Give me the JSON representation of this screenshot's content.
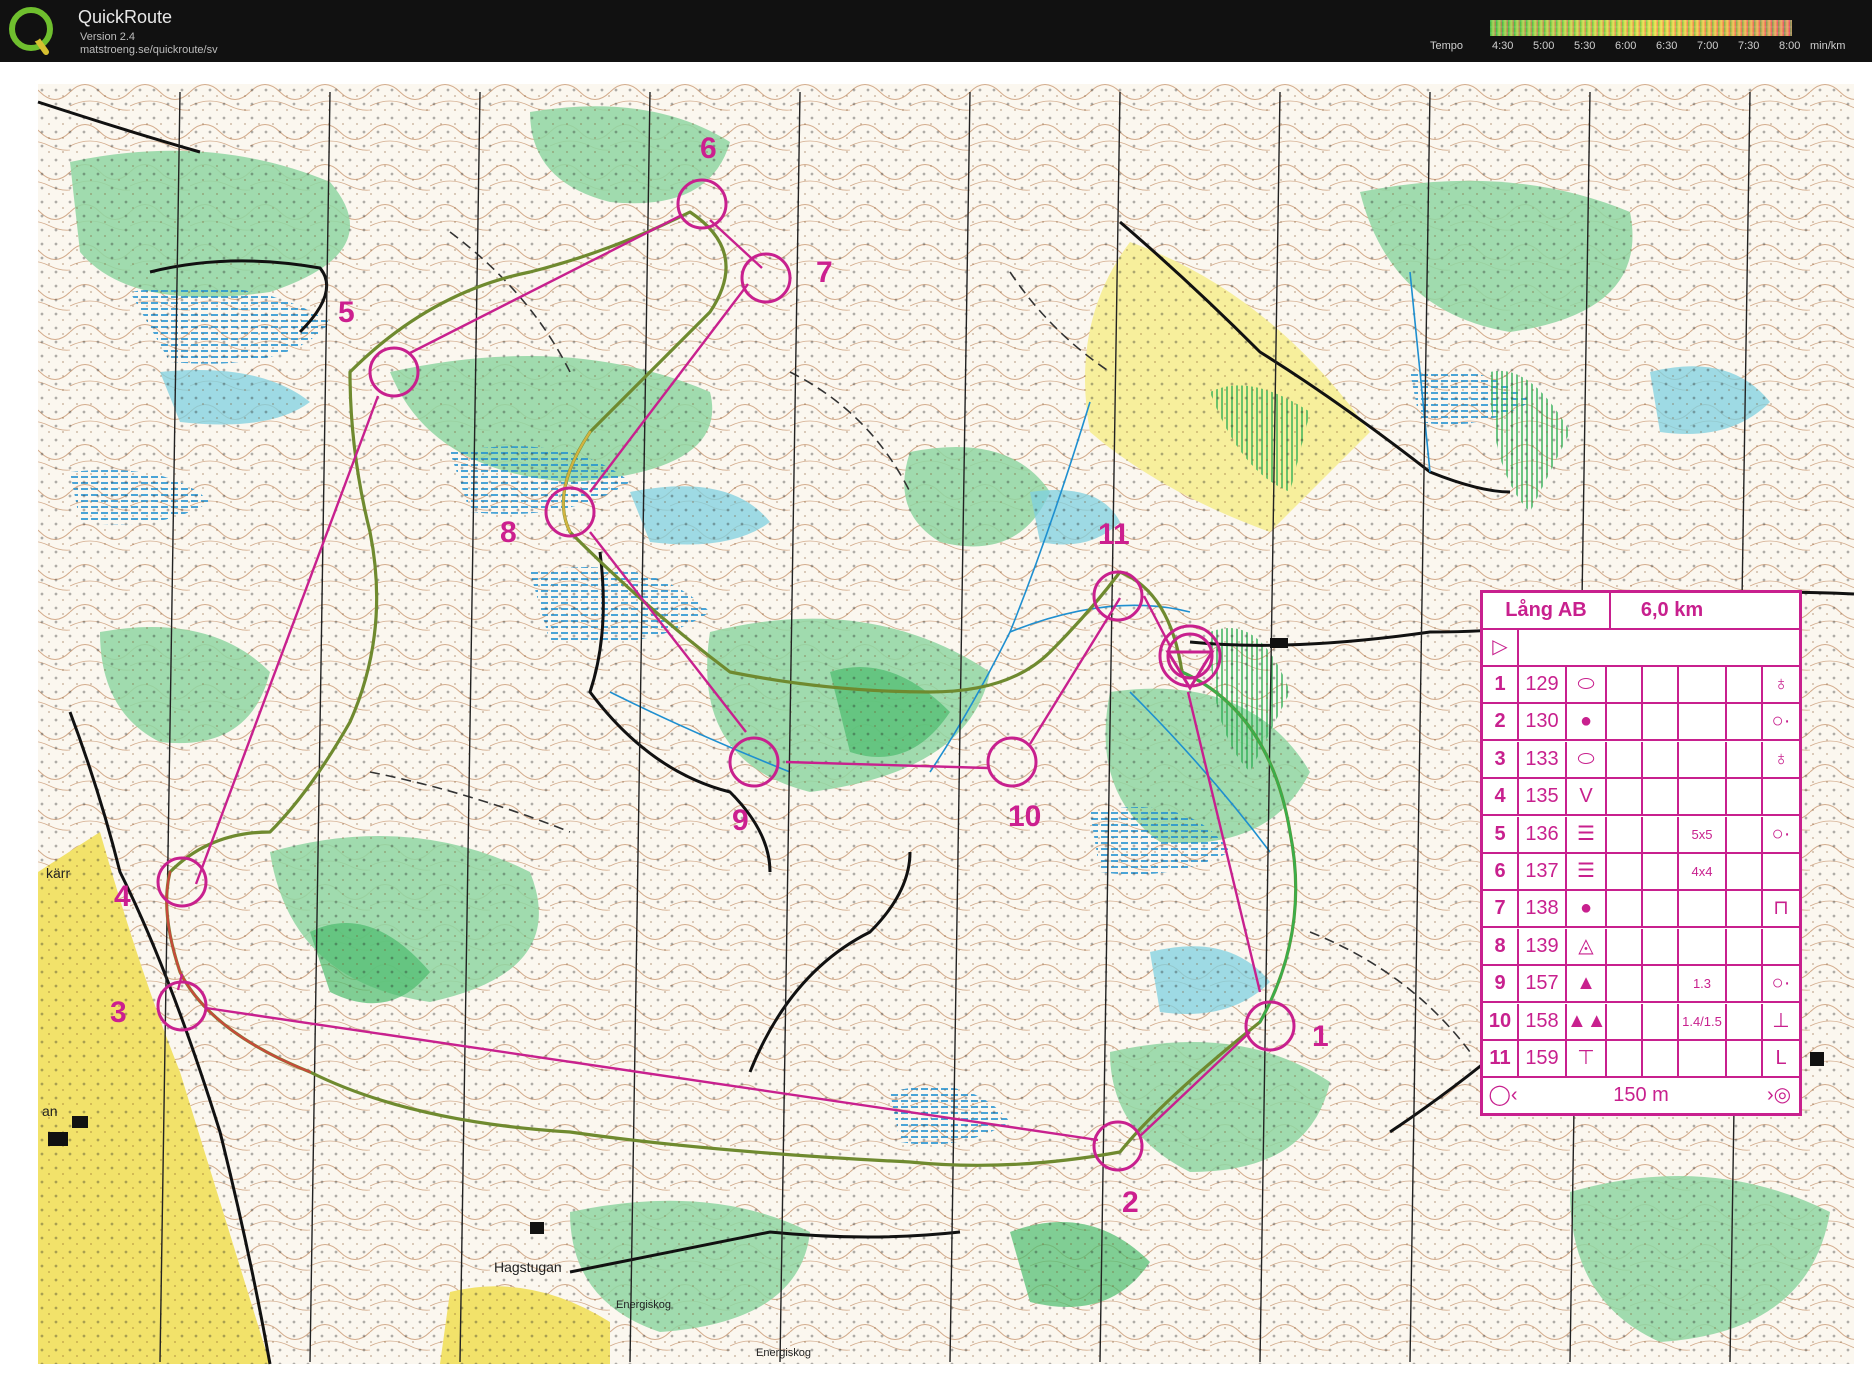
{
  "app": {
    "title": "QuickRoute",
    "version": "Version 2.4",
    "url": "matstroeng.se/quickroute/sv"
  },
  "tempo_legend": {
    "label": "Tempo",
    "ticks": [
      "4:30",
      "5:00",
      "5:30",
      "6:00",
      "6:30",
      "7:00",
      "7:30",
      "8:00"
    ],
    "unit": "min/km",
    "colors": [
      "#33b54a",
      "#8fd24a",
      "#d6e84c",
      "#f6e44a",
      "#f5b94a",
      "#f08b4a",
      "#e85a5a",
      "#e04070"
    ]
  },
  "map": {
    "course_color": "#c8208e",
    "controls": [
      "1",
      "2",
      "3",
      "4",
      "5",
      "6",
      "7",
      "8",
      "9",
      "10",
      "11"
    ],
    "place_names": [
      "Hagstugan",
      "Energiskog",
      "Energiskog",
      "kärr",
      "an"
    ]
  },
  "control_card": {
    "title": "Lång AB",
    "length": "6,0 km",
    "rows": [
      {
        "num": "1",
        "code": "129",
        "extra": ""
      },
      {
        "num": "2",
        "code": "130",
        "extra": ""
      },
      {
        "num": "3",
        "code": "133",
        "extra": ""
      },
      {
        "num": "4",
        "code": "135",
        "extra": ""
      },
      {
        "num": "5",
        "code": "136",
        "extra": "5x5"
      },
      {
        "num": "6",
        "code": "137",
        "extra": "4x4"
      },
      {
        "num": "7",
        "code": "138",
        "extra": ""
      },
      {
        "num": "8",
        "code": "139",
        "extra": ""
      },
      {
        "num": "9",
        "code": "157",
        "extra": "1.3"
      },
      {
        "num": "10",
        "code": "158",
        "extra": "1.4/1.5"
      },
      {
        "num": "11",
        "code": "159",
        "extra": ""
      }
    ],
    "finish": "150 m"
  }
}
